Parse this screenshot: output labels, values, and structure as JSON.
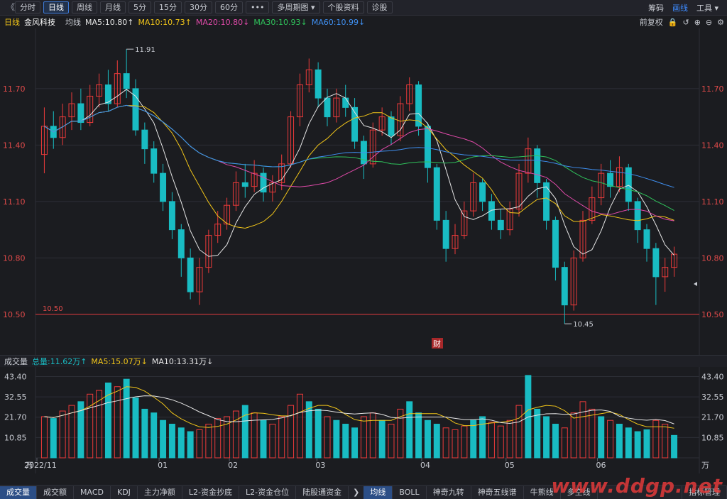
{
  "toolbar": {
    "back": "《",
    "buttons": [
      "分时",
      "日线",
      "周线",
      "月线",
      "5分",
      "15分",
      "30分",
      "60分",
      "•••",
      "多周期图 ▾",
      "个股资料",
      "诊股"
    ],
    "active_index": 1,
    "right": [
      "筹码",
      "画线",
      "工具 ▾"
    ],
    "right_active_index": 1
  },
  "ma_row": {
    "period": "日线",
    "stock": "金风科技",
    "avg": "均线",
    "items": [
      {
        "text": "MA5:10.80↑",
        "color": "#e6e6e6"
      },
      {
        "text": "MA10:10.73↑",
        "color": "#f0c419"
      },
      {
        "text": "MA20:10.80↓",
        "color": "#e04aa9"
      },
      {
        "text": "MA30:10.93↓",
        "color": "#2fc25b"
      },
      {
        "text": "MA60:10.99↓",
        "color": "#3f8ff0"
      }
    ],
    "right_label": "前复权"
  },
  "volume_head": {
    "title": "成交量",
    "total": "总量:11.62万↑",
    "ma5": "MA5:15.07万↓",
    "ma10": "MA10:13.31万↓"
  },
  "tabs": {
    "left": [
      "成交量",
      "成交额",
      "MACD",
      "KDJ",
      "主力净额",
      "L2-资金抄底",
      "L2-资金仓位",
      "陆股通资金"
    ],
    "left_active": 0,
    "middle": [
      "均线",
      "BOLL",
      "神奇九转",
      "神奇五线谱",
      "牛熊线",
      "多空线"
    ],
    "middle_active": 0,
    "right": "指标管理"
  },
  "watermark": "www.ddgp.net",
  "colors": {
    "up": "#ec3a3a",
    "down": "#19bcc3",
    "ma5": "#e6e6e6",
    "ma10": "#f0c419",
    "ma20": "#e04aa9",
    "ma30": "#2fc25b",
    "ma60": "#3f8ff0"
  },
  "chart_data": [
    {
      "type": "candlestick",
      "title": "金风科技 日线",
      "y_ticks": [
        11.7,
        11.4,
        11.1,
        10.8,
        10.5
      ],
      "ylim": [
        10.36,
        11.99
      ],
      "support_line": 10.5,
      "support_label": "10.50",
      "high_label": "11.91",
      "low_label": "10.45",
      "event_marker": "财",
      "x_labels": [
        "2022/11",
        "01",
        "02",
        "03",
        "04",
        "05",
        "06"
      ],
      "candles": [
        [
          11.35,
          11.5,
          11.6,
          11.25
        ],
        [
          11.5,
          11.44,
          11.58,
          11.38
        ],
        [
          11.44,
          11.55,
          11.62,
          11.4
        ],
        [
          11.55,
          11.62,
          11.68,
          11.48
        ],
        [
          11.62,
          11.52,
          11.7,
          11.48
        ],
        [
          11.52,
          11.66,
          11.72,
          11.5
        ],
        [
          11.66,
          11.72,
          11.78,
          11.6
        ],
        [
          11.72,
          11.62,
          11.8,
          11.58
        ],
        [
          11.62,
          11.78,
          11.85,
          11.6
        ],
        [
          11.78,
          11.7,
          11.91,
          11.65
        ],
        [
          11.7,
          11.48,
          11.75,
          11.45
        ],
        [
          11.48,
          11.38,
          11.52,
          11.3
        ],
        [
          11.38,
          11.25,
          11.42,
          11.2
        ],
        [
          11.25,
          11.1,
          11.3,
          11.05
        ],
        [
          11.1,
          10.95,
          11.15,
          10.9
        ],
        [
          10.95,
          10.8,
          10.98,
          10.7
        ],
        [
          10.8,
          10.62,
          10.85,
          10.58
        ],
        [
          10.62,
          10.75,
          10.8,
          10.55
        ],
        [
          10.75,
          10.92,
          10.95,
          10.72
        ],
        [
          10.92,
          10.98,
          11.05,
          10.88
        ],
        [
          10.98,
          11.08,
          11.12,
          10.95
        ],
        [
          11.08,
          11.2,
          11.26,
          11.05
        ],
        [
          11.2,
          11.18,
          11.3,
          11.12
        ],
        [
          11.18,
          11.25,
          11.32,
          11.15
        ],
        [
          11.25,
          11.15,
          11.28,
          11.1
        ],
        [
          11.15,
          11.2,
          11.24,
          11.1
        ],
        [
          11.2,
          11.3,
          11.35,
          11.16
        ],
        [
          11.3,
          11.55,
          11.58,
          11.28
        ],
        [
          11.55,
          11.72,
          11.78,
          11.5
        ],
        [
          11.72,
          11.8,
          11.86,
          11.68
        ],
        [
          11.8,
          11.65,
          11.84,
          11.6
        ],
        [
          11.65,
          11.55,
          11.7,
          11.5
        ],
        [
          11.55,
          11.65,
          11.7,
          11.52
        ],
        [
          11.65,
          11.6,
          11.72,
          11.55
        ],
        [
          11.6,
          11.42,
          11.65,
          11.38
        ],
        [
          11.42,
          11.3,
          11.45,
          11.22
        ],
        [
          11.3,
          11.48,
          11.52,
          11.28
        ],
        [
          11.48,
          11.55,
          11.6,
          11.45
        ],
        [
          11.55,
          11.45,
          11.58,
          11.4
        ],
        [
          11.45,
          11.62,
          11.66,
          11.42
        ],
        [
          11.62,
          11.72,
          11.76,
          11.58
        ],
        [
          11.72,
          11.5,
          11.74,
          11.45
        ],
        [
          11.5,
          11.28,
          11.52,
          11.2
        ],
        [
          11.28,
          11.0,
          11.3,
          10.95
        ],
        [
          11.0,
          10.85,
          11.05,
          10.78
        ],
        [
          10.85,
          10.92,
          10.98,
          10.82
        ],
        [
          10.92,
          11.05,
          11.1,
          10.9
        ],
        [
          11.05,
          11.2,
          11.25,
          11.02
        ],
        [
          11.2,
          11.1,
          11.22,
          11.05
        ],
        [
          11.1,
          11.0,
          11.14,
          10.95
        ],
        [
          11.0,
          10.95,
          11.06,
          10.9
        ],
        [
          10.95,
          11.06,
          11.1,
          10.92
        ],
        [
          11.06,
          11.25,
          11.3,
          11.02
        ],
        [
          11.25,
          11.38,
          11.44,
          11.2
        ],
        [
          11.38,
          11.2,
          11.4,
          11.12
        ],
        [
          11.2,
          11.0,
          11.22,
          10.95
        ],
        [
          11.0,
          10.75,
          11.02,
          10.68
        ],
        [
          10.75,
          10.55,
          10.78,
          10.45
        ],
        [
          10.55,
          10.8,
          10.84,
          10.52
        ],
        [
          10.8,
          11.0,
          11.05,
          10.78
        ],
        [
          11.0,
          11.12,
          11.18,
          10.98
        ],
        [
          11.12,
          11.25,
          11.3,
          11.08
        ],
        [
          11.25,
          11.18,
          11.32,
          11.12
        ],
        [
          11.18,
          11.28,
          11.34,
          11.15
        ],
        [
          11.28,
          11.1,
          11.3,
          11.05
        ],
        [
          11.1,
          10.95,
          11.12,
          10.88
        ],
        [
          10.95,
          10.85,
          10.98,
          10.78
        ],
        [
          10.85,
          10.7,
          10.88,
          10.55
        ],
        [
          10.7,
          10.75,
          10.8,
          10.62
        ],
        [
          10.75,
          10.82,
          10.86,
          10.7
        ]
      ]
    },
    {
      "type": "bar",
      "title": "成交量",
      "y_ticks": [
        43.4,
        32.55,
        21.7,
        10.85
      ],
      "y_unit": "万",
      "ylim": [
        0,
        47
      ],
      "values": [
        22,
        21,
        25,
        28,
        30,
        34,
        36,
        40,
        38,
        42,
        32,
        26,
        24,
        20,
        18,
        16,
        14,
        15,
        18,
        21,
        22,
        25,
        28,
        24,
        20,
        18,
        22,
        28,
        34,
        30,
        26,
        22,
        20,
        18,
        16,
        22,
        24,
        20,
        18,
        26,
        30,
        24,
        20,
        18,
        16,
        15,
        17,
        20,
        22,
        19,
        17,
        20,
        28,
        44,
        26,
        22,
        18,
        16,
        24,
        30,
        26,
        22,
        20,
        18,
        16,
        14,
        15,
        20,
        18,
        12
      ],
      "up_flags": [
        1,
        0,
        1,
        1,
        0,
        1,
        1,
        0,
        1,
        0,
        0,
        0,
        0,
        0,
        0,
        0,
        0,
        1,
        1,
        1,
        1,
        1,
        0,
        1,
        0,
        1,
        1,
        1,
        1,
        0,
        0,
        1,
        0,
        0,
        0,
        1,
        1,
        0,
        1,
        1,
        0,
        0,
        0,
        0,
        1,
        1,
        1,
        0,
        0,
        1,
        1,
        1,
        1,
        0,
        0,
        0,
        0,
        1,
        1,
        1,
        1,
        0,
        1,
        0,
        0,
        0,
        0,
        1,
        1,
        0
      ]
    }
  ]
}
